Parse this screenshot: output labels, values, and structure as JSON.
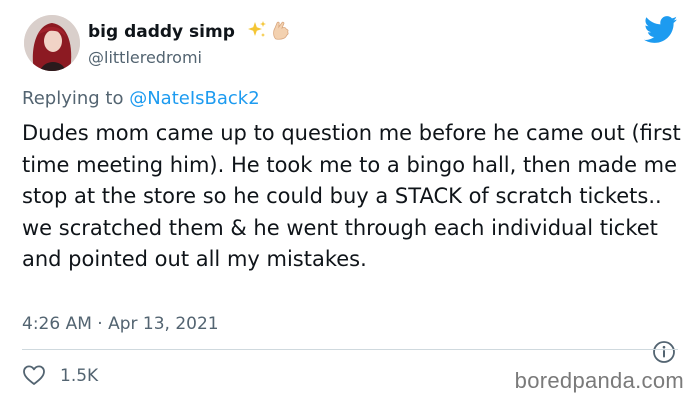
{
  "author": {
    "display_name": "big daddy simp",
    "handle": "@littleredromi",
    "name_emojis": [
      "sparkles-emoji",
      "ok-hand-emoji"
    ]
  },
  "reply": {
    "prefix": "Replying to",
    "mention": "@NateIsBack2"
  },
  "tweet": {
    "text": "Dudes mom came up to question me before he came out (first time meeting him). He took me to a bingo hall, then made me stop at the store so he could buy a STACK of scratch tickets.. we scratched them & he went through each individual ticket and pointed out all my mistakes.",
    "timestamp": "4:26 AM · Apr 13, 2021"
  },
  "engagement": {
    "likes": "1.5K"
  },
  "watermark": "boredpanda.com",
  "colors": {
    "twitter_blue": "#1d9bf0",
    "text_secondary": "#536471",
    "divider": "#cfd9de"
  }
}
